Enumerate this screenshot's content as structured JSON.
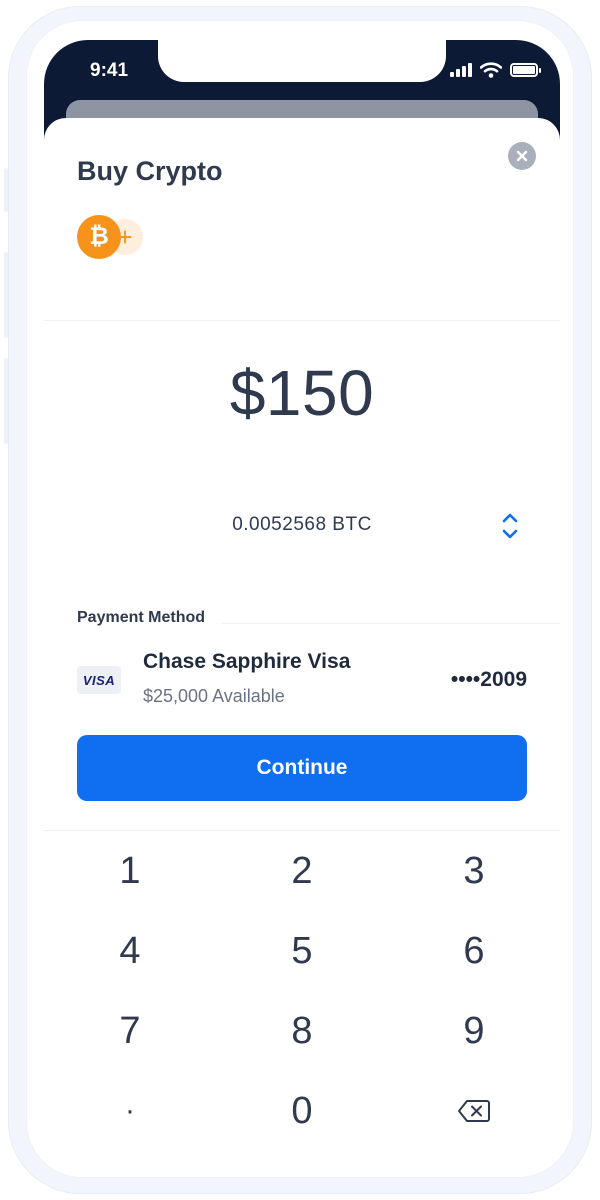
{
  "status_bar": {
    "time": "9:41",
    "icons": [
      "signal-icon",
      "wifi-icon",
      "battery-icon"
    ]
  },
  "header": {
    "title": "Buy Crypto",
    "close_icon": "close-icon"
  },
  "assets": {
    "selected_coin_symbol": "₿",
    "selected_coin_icon": "bitcoin-icon",
    "add_symbol": "+",
    "add_icon": "add-coin-icon"
  },
  "amount": {
    "fiat": "$150",
    "crypto": "0.0052568 BTC",
    "swap_icon": "swap-units-icon"
  },
  "payment": {
    "section_label": "Payment Method",
    "card_brand": "VISA",
    "card_name": "Chase Sapphire Visa",
    "available": "$25,000 Available",
    "last4": "••••2009"
  },
  "actions": {
    "continue_label": "Continue"
  },
  "keypad": {
    "keys": [
      "1",
      "2",
      "3",
      "4",
      "5",
      "6",
      "7",
      "8",
      "9",
      "·",
      "0"
    ],
    "backspace_icon": "backspace-icon"
  },
  "colors": {
    "accent": "#0f6ff0",
    "bitcoin": "#f7931a",
    "status_bar_bg": "#0d1a36",
    "text_primary": "#2f3a4f"
  }
}
